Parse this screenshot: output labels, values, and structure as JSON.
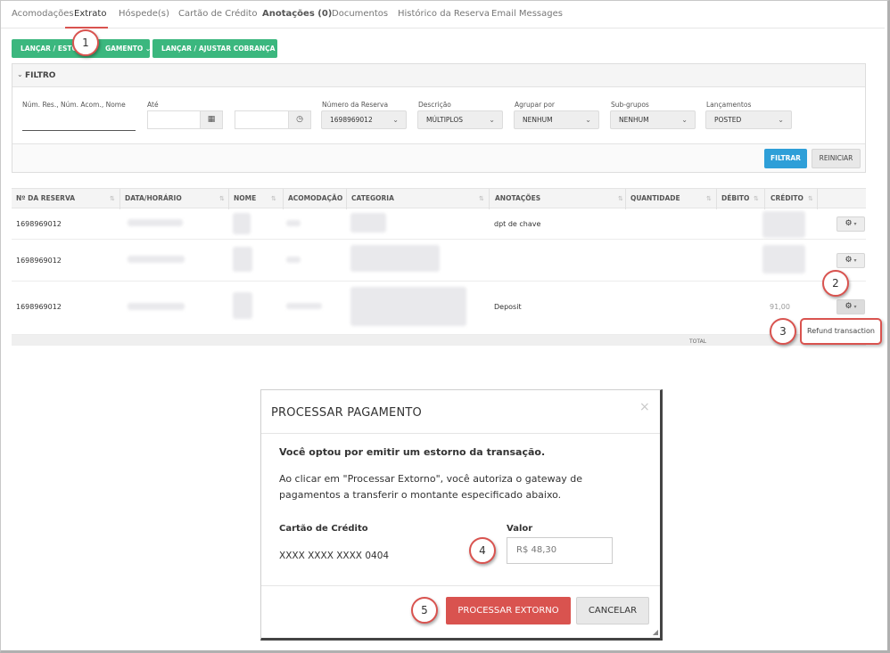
{
  "tabs": [
    {
      "label": "Acomodações"
    },
    {
      "label": "Extrato"
    },
    {
      "label": "Hóspede(s)"
    },
    {
      "label": "Cartão de Crédito"
    },
    {
      "label": "Anotações (0)"
    },
    {
      "label": "Documentos"
    },
    {
      "label": "Histórico da Reserva"
    },
    {
      "label": "Email Messages"
    }
  ],
  "actions": {
    "lancar_estornar": "LANÇAR / ESTO",
    "lancar_estornar_tail": "GAMENTO",
    "lancar_ajustar": "LANÇAR / AJUSTAR COBRANÇA"
  },
  "filter": {
    "title": "FILTRO",
    "search_label": "Núm. Res., Núm. Acom., Nome",
    "ate_label": "Até",
    "reserva_label": "Número da Reserva",
    "reserva_value": "1698969012",
    "descricao_label": "Descrição",
    "descricao_value": "MÚLTIPLOS",
    "agrupar_label": "Agrupar por",
    "agrupar_value": "NENHUM",
    "subgrupos_label": "Sub-grupos",
    "subgrupos_value": "NENHUM",
    "lancamentos_label": "Lançamentos",
    "lancamentos_value": "POSTED",
    "filtrar": "FILTRAR",
    "reiniciar": "REINICIAR"
  },
  "table": {
    "headers": [
      "Nº DA RESERVA",
      "DATA/HORÁRIO",
      "NOME",
      "ACOMODAÇÃO",
      "CATEGORIA",
      "ANOTAÇÕES",
      "QUANTIDADE",
      "DÉBITO",
      "CRÉDITO"
    ],
    "rows": [
      {
        "reserva": "1698969012",
        "anotacoes": "dpt de chave",
        "credito": ""
      },
      {
        "reserva": "1698969012",
        "anotacoes": "",
        "credito": ""
      },
      {
        "reserva": "1698969012",
        "anotacoes": "Deposit",
        "credito": "91,00"
      }
    ],
    "total_label": "TOTAL"
  },
  "dropdown": {
    "refund": "Refund transaction"
  },
  "callouts": [
    "1",
    "2",
    "3",
    "4",
    "5"
  ],
  "modal": {
    "title": "PROCESSAR PAGAMENTO",
    "close": "×",
    "line1": "Você optou por emitir um estorno da transação.",
    "line2": "Ao clicar em \"Processar Extorno\", você autoriza o gateway de",
    "line3": "pagamentos a transferir o montante especificado abaixo.",
    "card_label": "Cartão de Crédito",
    "card_value": "XXXX XXXX XXXX 0404",
    "valor_label": "Valor",
    "valor_value": "R$ 48,30",
    "processar": "PROCESSAR EXTORNO",
    "cancelar": "CANCELAR"
  },
  "colors": {
    "accent": "#d9534f",
    "green": "#3bb77e",
    "blue": "#2e9fd8"
  }
}
